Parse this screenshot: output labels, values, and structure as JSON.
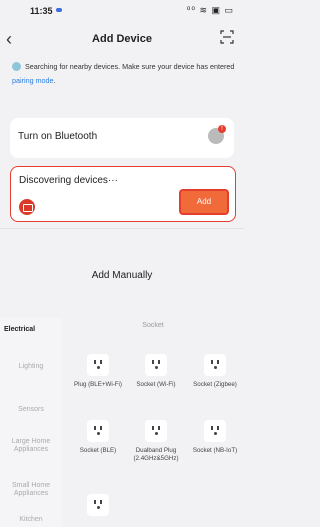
{
  "status": {
    "time": "11:35",
    "icons_text": "⁰⁰ ≋ ▣ ▭"
  },
  "header": {
    "title": "Add Device"
  },
  "info": {
    "text": "Searching for nearby devices. Make sure your device has entered ",
    "link": "pairing mode",
    "end": "."
  },
  "bluetooth": {
    "label": "Turn on Bluetooth",
    "badge": "!"
  },
  "discovering": {
    "label": "Discovering devices···",
    "add_label": "Add"
  },
  "manual": {
    "title": "Add Manually"
  },
  "category": {
    "title": "Socket"
  },
  "sidebar": [
    {
      "label": "Electrical"
    },
    {
      "label": "Lighting"
    },
    {
      "label": "Sensors"
    },
    {
      "label": "Large Home Appliances"
    },
    {
      "label": "Small Home Appliances"
    },
    {
      "label": "Kitchen"
    }
  ],
  "devices": [
    {
      "label": "Plug (BLE+Wi-Fi)"
    },
    {
      "label": "Socket (Wi-Fi)"
    },
    {
      "label": "Socket (Zigbee)"
    },
    {
      "label": "Socket (BLE)"
    },
    {
      "label": "Dualband Plug (2.4GHz&5GHz)"
    },
    {
      "label": "Socket (NB-IoT)"
    },
    {
      "label": ""
    }
  ]
}
